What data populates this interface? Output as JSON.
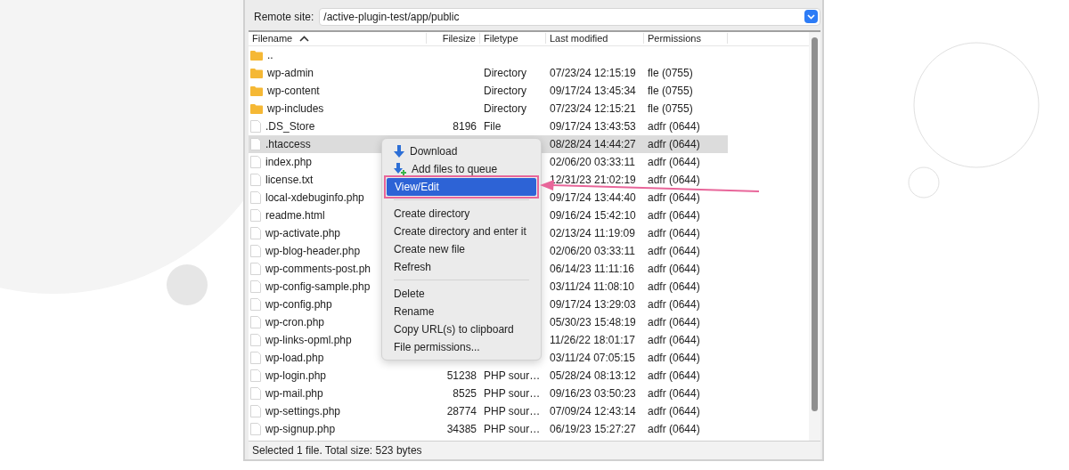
{
  "remote_site": {
    "label": "Remote site:",
    "value": "/active-plugin-test/app/public"
  },
  "table": {
    "columns": [
      {
        "label": "Filename",
        "sorted": true
      },
      {
        "label": "Filesize",
        "sorted": false
      },
      {
        "label": "Filetype",
        "sorted": false
      },
      {
        "label": "Last modified",
        "sorted": false
      },
      {
        "label": "Permissions",
        "sorted": false
      }
    ],
    "rows": [
      {
        "kind": "folder",
        "name": "..",
        "selected": false
      },
      {
        "kind": "folder",
        "name": "wp-admin",
        "filetype": "Directory",
        "modified": "07/23/24 12:15:19",
        "permissions": "fle (0755)",
        "selected": false
      },
      {
        "kind": "folder",
        "name": "wp-content",
        "filetype": "Directory",
        "modified": "09/17/24 13:45:34",
        "permissions": "fle (0755)",
        "selected": false
      },
      {
        "kind": "folder",
        "name": "wp-includes",
        "filetype": "Directory",
        "modified": "07/23/24 12:15:21",
        "permissions": "fle (0755)",
        "selected": false
      },
      {
        "kind": "file",
        "name": ".DS_Store",
        "filesize": "8196",
        "filetype": "File",
        "modified": "09/17/24 13:43:53",
        "permissions": "adfr (0644)",
        "selected": false
      },
      {
        "kind": "file",
        "name": ".htaccess",
        "modified": "08/28/24 14:44:27",
        "permissions": "adfr (0644)",
        "selected": true
      },
      {
        "kind": "file",
        "name": "index.php",
        "modified": "02/06/20 03:33:11",
        "permissions": "adfr (0644)",
        "selected": false
      },
      {
        "kind": "file",
        "name": "license.txt",
        "modified": "12/31/23 21:02:19",
        "permissions": "adfr (0644)",
        "selected": false
      },
      {
        "kind": "file",
        "name": "local-xdebuginfo.php",
        "modified": "09/17/24 13:44:40",
        "permissions": "adfr (0644)",
        "selected": false
      },
      {
        "kind": "file",
        "name": "readme.html",
        "modified": "09/16/24 15:42:10",
        "permissions": "adfr (0644)",
        "selected": false
      },
      {
        "kind": "file",
        "name": "wp-activate.php",
        "modified": "02/13/24 11:19:09",
        "permissions": "adfr (0644)",
        "selected": false
      },
      {
        "kind": "file",
        "name": "wp-blog-header.php",
        "modified": "02/06/20 03:33:11",
        "permissions": "adfr (0644)",
        "selected": false
      },
      {
        "kind": "file",
        "name": "wp-comments-post.ph",
        "modified": "06/14/23 11:11:16",
        "permissions": "adfr (0644)",
        "selected": false
      },
      {
        "kind": "file",
        "name": "wp-config-sample.php",
        "modified": "03/11/24 11:08:10",
        "permissions": "adfr (0644)",
        "selected": false
      },
      {
        "kind": "file",
        "name": "wp-config.php",
        "modified": "09/17/24 13:29:03",
        "permissions": "adfr (0644)",
        "selected": false
      },
      {
        "kind": "file",
        "name": "wp-cron.php",
        "modified": "05/30/23 15:48:19",
        "permissions": "adfr (0644)",
        "selected": false
      },
      {
        "kind": "file",
        "name": "wp-links-opml.php",
        "modified": "11/26/22 18:01:17",
        "permissions": "adfr (0644)",
        "selected": false
      },
      {
        "kind": "file",
        "name": "wp-load.php",
        "modified": "03/11/24 07:05:15",
        "permissions": "adfr (0644)",
        "selected": false
      },
      {
        "kind": "file",
        "name": "wp-login.php",
        "filesize": "51238",
        "filetype": "PHP sour…",
        "modified": "05/28/24 08:13:12",
        "permissions": "adfr (0644)",
        "selected": false
      },
      {
        "kind": "file",
        "name": "wp-mail.php",
        "filesize": "8525",
        "filetype": "PHP sour…",
        "modified": "09/16/23 03:50:23",
        "permissions": "adfr (0644)",
        "selected": false
      },
      {
        "kind": "file",
        "name": "wp-settings.php",
        "filesize": "28774",
        "filetype": "PHP sour…",
        "modified": "07/09/24 12:43:14",
        "permissions": "adfr (0644)",
        "selected": false
      },
      {
        "kind": "file",
        "name": "wp-signup.php",
        "filesize": "34385",
        "filetype": "PHP sour…",
        "modified": "06/19/23 15:27:27",
        "permissions": "adfr (0644)",
        "selected": false
      }
    ]
  },
  "context_menu": [
    {
      "kind": "download",
      "label": "Download",
      "selected": false,
      "highlighted": false
    },
    {
      "kind": "queue",
      "label": "Add files to queue",
      "selected": false,
      "highlighted": false
    },
    {
      "kind": "item",
      "label": "View/Edit",
      "selected": true,
      "highlighted": true
    },
    {
      "kind": "separator"
    },
    {
      "kind": "item",
      "label": "Create directory",
      "selected": false,
      "highlighted": false
    },
    {
      "kind": "item",
      "label": "Create directory and enter it",
      "selected": false,
      "highlighted": false
    },
    {
      "kind": "item",
      "label": "Create new file",
      "selected": false,
      "highlighted": false
    },
    {
      "kind": "item",
      "label": "Refresh",
      "selected": false,
      "highlighted": false
    },
    {
      "kind": "separator"
    },
    {
      "kind": "item",
      "label": "Delete",
      "selected": false,
      "highlighted": false
    },
    {
      "kind": "item",
      "label": "Rename",
      "selected": false,
      "highlighted": false
    },
    {
      "kind": "item",
      "label": "Copy URL(s) to clipboard",
      "selected": false,
      "highlighted": false
    },
    {
      "kind": "item",
      "label": "File permissions...",
      "selected": false,
      "highlighted": false
    }
  ],
  "status_bar": "Selected 1 file. Total size: 523 bytes"
}
